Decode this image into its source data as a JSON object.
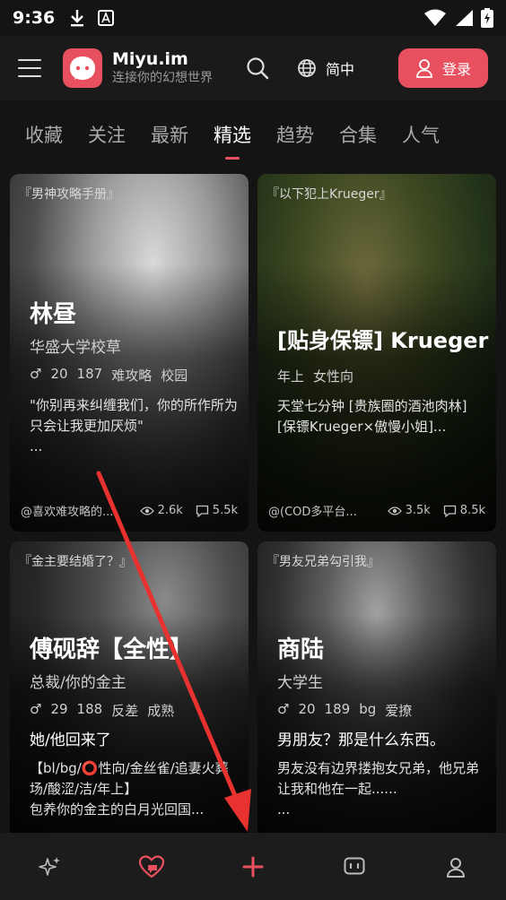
{
  "status_bar": {
    "time": "9:36"
  },
  "header": {
    "brand_name": "Miyu.im",
    "brand_tagline": "连接你的幻想世界",
    "language": "简中",
    "login_label": "登录"
  },
  "tabs": [
    {
      "label": "收藏",
      "active": false
    },
    {
      "label": "关注",
      "active": false
    },
    {
      "label": "最新",
      "active": false
    },
    {
      "label": "精选",
      "active": true
    },
    {
      "label": "趋势",
      "active": false
    },
    {
      "label": "合集",
      "active": false
    },
    {
      "label": "人气",
      "active": false
    }
  ],
  "cards": [
    {
      "tag": "『男神攻略手册』",
      "name": "林昼",
      "subtitle": "华盛大学校草",
      "gender": "♂",
      "meta": [
        "20",
        "187",
        "难攻略",
        "校园"
      ],
      "desc": "\"你别再来纠缠我们，你的所作所为只会让我更加厌烦\"\n...",
      "author": "@喜欢难攻略的...",
      "views": "2.6k",
      "comments": "5.5k"
    },
    {
      "tag": "『以下犯上Krueger』",
      "name": "[贴身保镖] Krueger",
      "subtitle": "",
      "gender": "",
      "meta": [
        "年上",
        "女性向"
      ],
      "desc": "天堂七分钟 [贵族圈的酒池肉林]\n[保镖Krueger×傲慢小姐]...",
      "author": "@(COD多平台...",
      "views": "3.5k",
      "comments": "8.5k"
    },
    {
      "tag": "『金主要结婚了？』",
      "name": "傅砚辞【全性】",
      "subtitle": "总裁/你的金主",
      "gender": "♂",
      "meta": [
        "29",
        "188",
        "反差",
        "成熟"
      ],
      "lead": "她/他回来了",
      "desc": "【bl/bg/⭕性向/金丝雀/追妻火葬场/酸涩/洁/年上】\n包养你的金主的白月光回国...",
      "author": "",
      "views": "",
      "comments": ""
    },
    {
      "tag": "『男友兄弟勾引我』",
      "name": "商陆",
      "subtitle": "大学生",
      "gender": "♂",
      "meta": [
        "20",
        "189",
        "bg",
        "爱撩"
      ],
      "lead": "男朋友？那是什么东西。",
      "desc": "男友没有边界搂抱女兄弟，他兄弟让我和他在一起......\n...",
      "author": "",
      "views": "",
      "comments": ""
    }
  ],
  "bottom_nav": [
    {
      "icon": "sparkle-icon",
      "active": false
    },
    {
      "icon": "heart-chat-icon",
      "active": true
    },
    {
      "icon": "plus-icon",
      "active": true
    },
    {
      "icon": "chat-bubble-icon",
      "active": false
    },
    {
      "icon": "user-icon",
      "active": false
    }
  ],
  "colors": {
    "accent": "#e8505f",
    "background": "#141414",
    "header": "#1a1a1a",
    "annotation_arrow": "#e8322f"
  }
}
